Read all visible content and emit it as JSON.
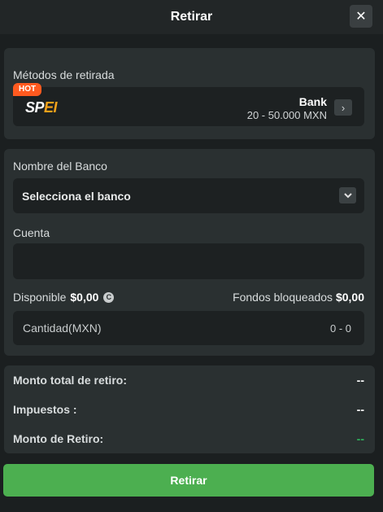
{
  "header": {
    "title": "Retirar",
    "close_icon": "close-icon",
    "close_glyph": "✕"
  },
  "methods": {
    "label": "Métodos de retirada",
    "card": {
      "badge": "HOT",
      "logo_text_white": "SP",
      "logo_text_orange": "EI",
      "name": "Bank",
      "range": "20 - 50.000 MXN",
      "chevron_glyph": "›"
    }
  },
  "form": {
    "bank_label": "Nombre del Banco",
    "bank_select_value": "Selecciona el banco",
    "account_label": "Cuenta",
    "account_value": "",
    "available_label": "Disponible",
    "available_value": "$0,00",
    "coin_glyph": "C",
    "blocked_label": "Fondos bloqueados",
    "blocked_value": "$0,00",
    "amount_placeholder": "Cantidad(MXN)",
    "amount_range": "0 - 0"
  },
  "summary": {
    "total_label": "Monto total de retiro:",
    "total_value": "--",
    "tax_label": "Impuestos :",
    "tax_value": "--",
    "withdraw_label": "Monto de Retiro:",
    "withdraw_value": "--"
  },
  "submit": {
    "label": "Retirar"
  },
  "colors": {
    "background": "#1b1f20",
    "panel": "#2a3031",
    "field": "#1d2122",
    "accent_green": "#4caf50",
    "hot_badge": "#ff5a1f",
    "value_green": "#2fb35c"
  }
}
